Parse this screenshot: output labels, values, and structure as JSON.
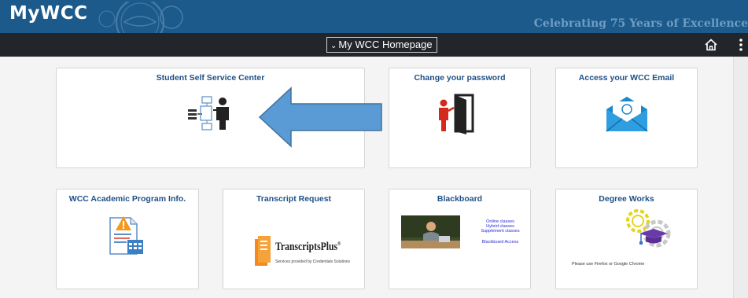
{
  "header": {
    "brand": "MyWCC",
    "tagline": "Celebrating 75 Years of Excellence"
  },
  "navbar": {
    "homepage_select": "My WCC Homepage",
    "home_icon": "home-icon",
    "more_icon": "more-vertical-icon"
  },
  "tiles": [
    {
      "title": "Student Self Service Center",
      "icon": "self-service-icon"
    },
    {
      "title": "Change your password",
      "icon": "password-door-icon"
    },
    {
      "title": "Access your WCC Email",
      "icon": "email-envelope-icon"
    },
    {
      "title": "WCC Academic Program Info.",
      "icon": "program-info-icon"
    },
    {
      "title": "Transcript Request",
      "icon": "transcriptsplus-logo",
      "logo_text": "TranscriptsPlus",
      "logo_mark": "®",
      "logo_subtext": "Services provided by Credentials Solutions"
    },
    {
      "title": "Blackboard",
      "icon": "blackboard-image",
      "lines": [
        "Online classes",
        "Hybrid classes",
        "Supplement classes"
      ],
      "access_text": "Blackboard Access"
    },
    {
      "title": "Degree Works",
      "icon": "degree-works-icon",
      "note": "Please use Firefox or Google Chrome"
    }
  ],
  "annotation": {
    "icon": "left-arrow-annotation",
    "color": "#5b9bd5"
  },
  "colors": {
    "banner": "#1c5a8c",
    "navbar": "#22262a",
    "tile_title": "#1f4f86"
  }
}
